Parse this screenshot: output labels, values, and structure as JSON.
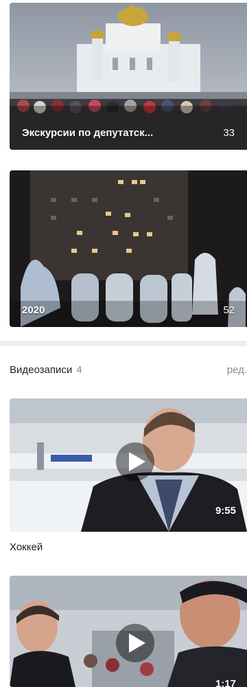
{
  "albums": [
    {
      "title": "Экскурсии по депутатск...",
      "count": "33"
    },
    {
      "title": "2020",
      "count": "52"
    }
  ],
  "videos_section": {
    "title": "Видеозаписи",
    "count": "4",
    "edit_label": "ред."
  },
  "videos": [
    {
      "title": "Хоккей",
      "duration": "9:55"
    },
    {
      "title": "",
      "duration": "1:17"
    }
  ]
}
